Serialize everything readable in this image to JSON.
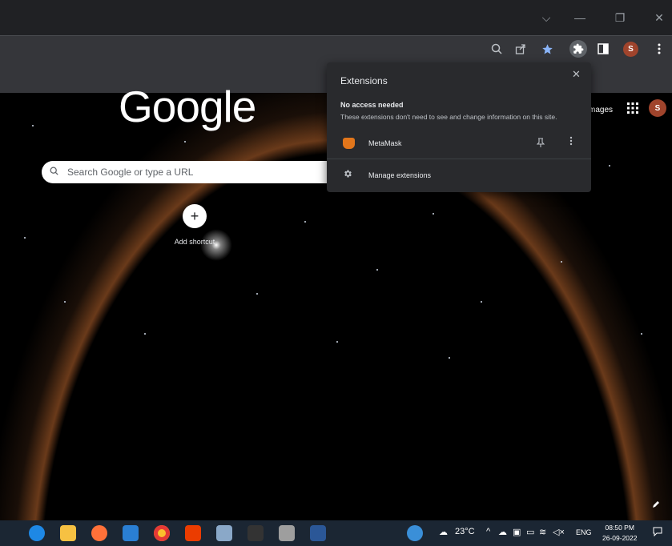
{
  "window": {
    "controls": {
      "dropdown": "⌵",
      "minimize": "—",
      "restore": "❐",
      "close": "✕"
    }
  },
  "toolbar": {
    "profile_initial": "S"
  },
  "ntp": {
    "logo_text": "Google",
    "search_placeholder": "Search Google or type a URL",
    "add_shortcut_label": "Add shortcut",
    "images_link": "mages",
    "avatar_initial": "S"
  },
  "extensions_popup": {
    "title": "Extensions",
    "section_heading": "No access needed",
    "section_description": "These extensions don't need to see and change information on this site.",
    "extensions": [
      {
        "name": "MetaMask",
        "icon": "metamask-fox-icon"
      }
    ],
    "manage_label": "Manage extensions"
  },
  "taskbar": {
    "icons": [
      "edge-icon",
      "file-explorer-icon",
      "firefox-icon",
      "mail-icon",
      "chrome-icon",
      "office-icon",
      "sticky-notes-icon",
      "terminal-icon",
      "paint-icon",
      "word-icon"
    ],
    "weather": "23°C",
    "language": "ENG",
    "time": "08:50 PM",
    "date": "26-09-2022"
  },
  "colors": {
    "chrome_frame": "#202124",
    "toolbar": "#35363a",
    "popup_bg": "#292a2d",
    "profile": "#a0442c",
    "bookmark_star": "#8ab4f8",
    "taskbar": "#1b2633"
  }
}
